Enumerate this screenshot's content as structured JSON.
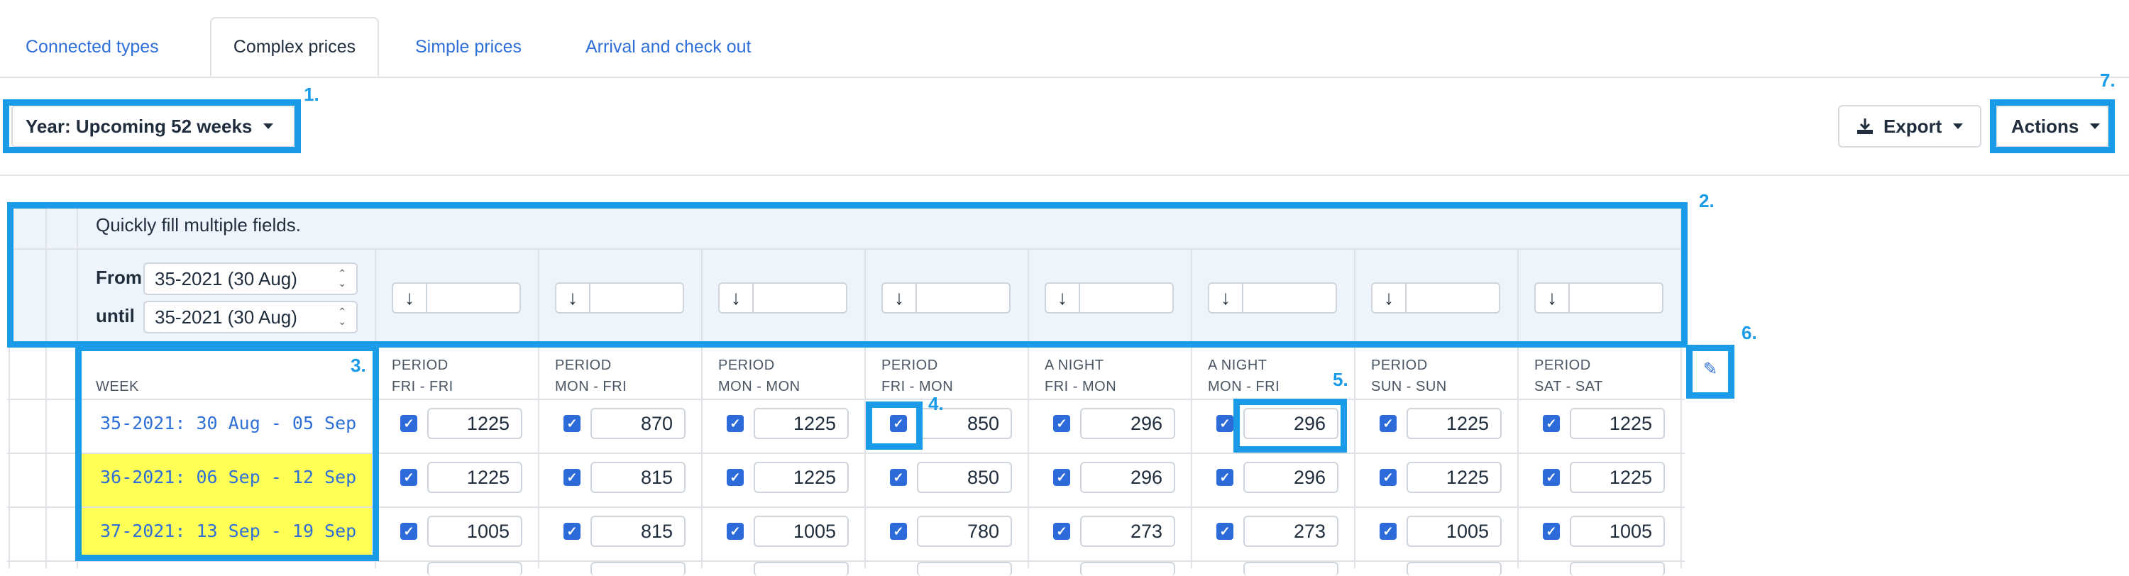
{
  "tabs": [
    {
      "label": "Connected types"
    },
    {
      "label": "Complex prices"
    },
    {
      "label": "Simple prices"
    },
    {
      "label": "Arrival and check out"
    }
  ],
  "toolbar": {
    "year_label": "Year: Upcoming 52 weeks",
    "export_label": "Export",
    "actions_label": "Actions"
  },
  "annotations": [
    "1.",
    "2.",
    "3.",
    "4.",
    "5.",
    "6.",
    "7."
  ],
  "quick_fill": {
    "title": "Quickly fill multiple fields.",
    "from_label": "From",
    "until_label": "until",
    "from_value": "35-2021 (30 Aug)",
    "until_value": "35-2021 (30 Aug)",
    "fill_icon": "arrow-down-icon"
  },
  "table": {
    "week_header": "WEEK",
    "columns": [
      {
        "line1": "PERIOD",
        "line2": "FRI - FRI"
      },
      {
        "line1": "PERIOD",
        "line2": "MON - FRI"
      },
      {
        "line1": "PERIOD",
        "line2": "MON - MON"
      },
      {
        "line1": "PERIOD",
        "line2": "FRI - MON"
      },
      {
        "line1": "A NIGHT",
        "line2": "FRI - MON"
      },
      {
        "line1": "A NIGHT",
        "line2": "MON - FRI"
      },
      {
        "line1": "PERIOD",
        "line2": "SUN - SUN"
      },
      {
        "line1": "PERIOD",
        "line2": "SAT - SAT"
      }
    ],
    "rows": [
      {
        "week": "35-2021: 30 Aug - 05 Sep",
        "values": [
          "1225",
          "870",
          "1225",
          "850",
          "296",
          "296",
          "1225",
          "1225"
        ]
      },
      {
        "week": "36-2021: 06 Sep - 12 Sep",
        "values": [
          "1225",
          "815",
          "1225",
          "850",
          "296",
          "296",
          "1225",
          "1225"
        ]
      },
      {
        "week": "37-2021: 13 Sep - 19 Sep",
        "values": [
          "1005",
          "815",
          "1005",
          "780",
          "273",
          "273",
          "1005",
          "1005"
        ]
      }
    ],
    "highlight_color": "#ffff55"
  },
  "colors": {
    "accent": "#1a9be8",
    "link": "#2f6fd8",
    "checkbox": "#2d6bdb"
  }
}
